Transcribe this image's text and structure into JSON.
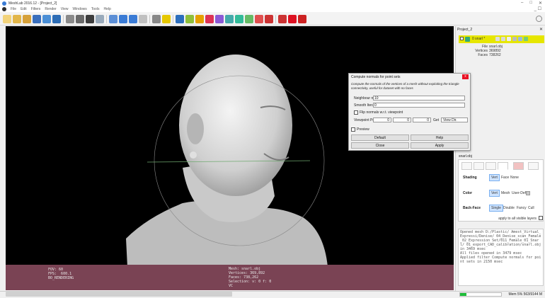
{
  "window": {
    "title": "MeshLab 2016.12 - [Project_2]",
    "controls": {
      "minimize": "–",
      "maximize": "□",
      "close": "✕"
    }
  },
  "menu": {
    "items": [
      "File",
      "Edit",
      "Filters",
      "Render",
      "View",
      "Windows",
      "Tools",
      "Help"
    ],
    "window_controls": "_ ☐"
  },
  "toolbar": {
    "buttons": [
      "open-project",
      "save-project",
      "import-mesh",
      "export-mesh",
      "snapshot",
      "reload",
      "layers",
      "bounding-box",
      "points",
      "wireframe",
      "flat-lines",
      "flat",
      "smooth",
      "texture",
      "light",
      "info",
      "align",
      "measure",
      "color",
      "paint",
      "select",
      "pick-points",
      "select-vertices",
      "select-faces",
      "manipulator",
      "annotation",
      "delete",
      "delete-faces",
      "delete-vertices"
    ],
    "colors": [
      "#f2d37b",
      "#e2b64a",
      "#d6a13a",
      "#3a6fbd",
      "#4b8fd6",
      "#2d6db5",
      "#8a8a8a",
      "#6a6a6a",
      "#3d3d3d",
      "#9ab",
      "#5c8fd6",
      "#3a7bd5",
      "#3a7bd5",
      "#c0c0c0",
      "#888",
      "#e6c800",
      "#2c6ebd",
      "#8fbf3a",
      "#e6a000",
      "#d35",
      "#8b5ad6",
      "#4aa",
      "#3b9",
      "#6b6",
      "#e05050",
      "#c33",
      "#c33",
      "#d12",
      "#c22"
    ]
  },
  "viewport": {
    "info_left": "FOV: 60\nFPS:  600.1\nBO_RENDERING",
    "info_right": "Mesh: snarl.obj\nVertices: 369,892\nFaces: 738,262\nSelection: v: 0 f: 0\nVC"
  },
  "layer_panel": {
    "title": "Project_2",
    "close": "✕",
    "layer_name": "0 snarl *",
    "file_label": "File",
    "file_value": "snarl.obj",
    "vertices_label": "Vertices",
    "vertices_value": "369892",
    "faces_label": "Faces",
    "faces_value": "738262"
  },
  "render_settings": {
    "mesh_label": "snarl.obj",
    "shading": {
      "label": "Shading",
      "options": [
        "Vert",
        "Face",
        "None"
      ]
    },
    "color": {
      "label": "Color",
      "options": [
        "Vert",
        "Mesh",
        "User-Def"
      ]
    },
    "back_face": {
      "label": "Back-Face",
      "options": [
        "Single",
        "Double",
        "Fancy",
        "Cull"
      ]
    },
    "apply_all": "apply to all visible layers"
  },
  "log": {
    "text": "Opened mesh D:/Plastic/ Amest_Virtual_Expressi/Denise/ 04_Denise_scan_Female_02_Expression Set/011_Female_01_Snarl/ 01_export_CAD_calibration/snarl.obj in 3469 msec\nAll files opened in 3479 msec\nApplied filter Compute normals for point sets in 2150 msec"
  },
  "statusbar": {
    "memory": "Mem 5% 563/9144 M",
    "progress": 0.15
  },
  "dialog": {
    "title": "Compute normals for point sets",
    "close": "x",
    "description": "Compute the normals of the vertices of a mesh without exploiting the triangle connectivity, useful for dataset with no faces",
    "neighbour_label": "Neighbour num",
    "neighbour_value": "10",
    "smooth_label": "Smooth Iteration",
    "smooth_value": "0",
    "flip_label": "Flip normals w.r.t. viewpoint",
    "viewpoint_label": "Viewpoint Pos.",
    "vp_x": "0",
    "vp_y": "0",
    "vp_z": "0",
    "get_label": "Get",
    "view_dir": "View Dir.",
    "preview_label": "Preview",
    "btn_default": "Default",
    "btn_help": "Help",
    "btn_close": "Close",
    "btn_apply": "Apply"
  }
}
